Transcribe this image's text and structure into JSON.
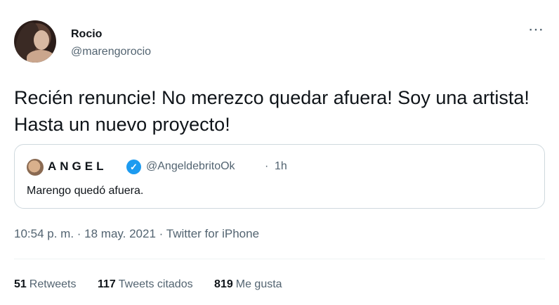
{
  "author": {
    "name": "Rocio",
    "handle": "@marengorocio"
  },
  "more_icon": "⋯",
  "tweet": {
    "text": "Recién renuncie! No merezco quedar afuera! Soy una artista! Hasta un nuevo proyecto!"
  },
  "quoted": {
    "name": "ANGEL",
    "verified_icon": "verified-badge",
    "handle": "@AngeldebritoOk",
    "separator": "·",
    "time": "1h",
    "text": "Marengo quedó afuera."
  },
  "meta": {
    "time": "10:54 p. m.",
    "sep1": " · ",
    "date": "18 may. 2021",
    "sep2": " · ",
    "source": "Twitter for iPhone"
  },
  "stats": [
    {
      "count": "51",
      "label": "Retweets"
    },
    {
      "count": "117",
      "label": "Tweets citados"
    },
    {
      "count": "819",
      "label": "Me gusta"
    }
  ],
  "colors": {
    "verified": "#1d9bf0",
    "secondary_text": "#536471",
    "border": "#cfd9de"
  }
}
